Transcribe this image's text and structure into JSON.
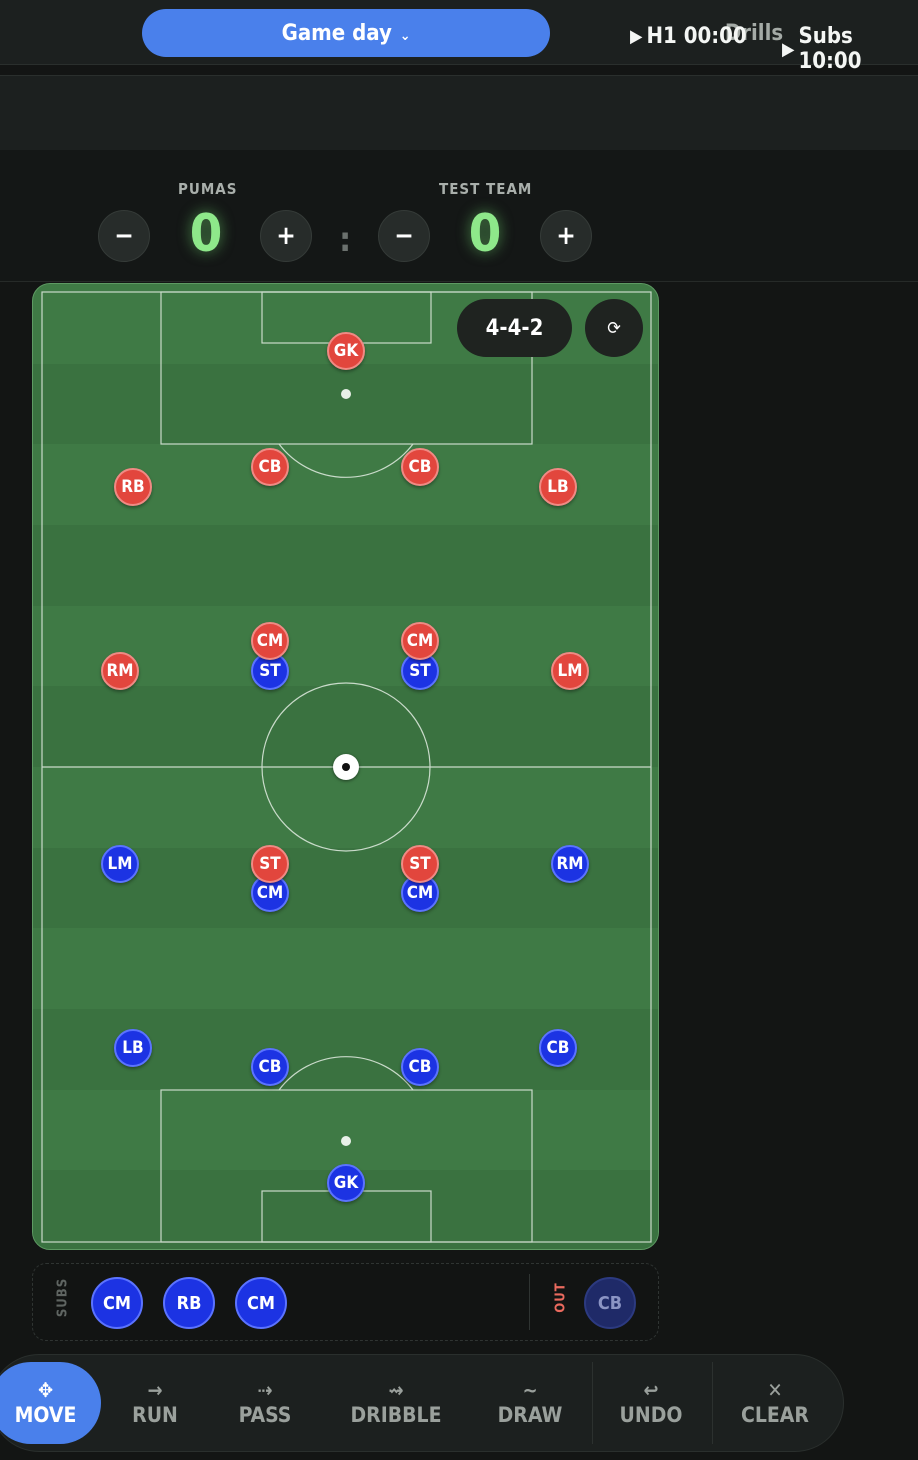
{
  "tabs": {
    "active": "Game day",
    "active_chevron": "⌄",
    "inactive": "Drills"
  },
  "timers": {
    "half": "H1 00:00",
    "subs": "Subs 10:00",
    "play_icon": "▶"
  },
  "score": {
    "home_name": "PUMAS",
    "home_score": "0",
    "away_name": "TEST TEAM",
    "away_score": "0",
    "minus": "−",
    "plus": "+",
    "separator": ":"
  },
  "pitch": {
    "formation": "4-4-2",
    "reset_icon": "⟳",
    "home_color": "#e2463d",
    "away_color": "#1c33e3",
    "red_players": [
      "GK",
      "CB",
      "CB",
      "RB",
      "LB",
      "CM",
      "CM",
      "RM",
      "LM",
      "ST",
      "ST"
    ],
    "blue_players": [
      "ST",
      "ST",
      "LM",
      "RM",
      "CM",
      "CM",
      "LB",
      "CB",
      "CB",
      "CB",
      "GK"
    ]
  },
  "subs": {
    "label": "SUBS",
    "players": [
      "CM",
      "RB",
      "CM"
    ],
    "out_label": "OUT",
    "out_players": [
      "CB"
    ]
  },
  "toolbar": [
    {
      "label": "MOVE",
      "icon": "✥"
    },
    {
      "label": "RUN",
      "icon": "→"
    },
    {
      "label": "PASS",
      "icon": "⇢"
    },
    {
      "label": "DRIBBLE",
      "icon": "⇝"
    },
    {
      "label": "DRAW",
      "icon": "∼"
    },
    {
      "label": "UNDO",
      "icon": "↩"
    },
    {
      "label": "CLEAR",
      "icon": "✕"
    }
  ]
}
